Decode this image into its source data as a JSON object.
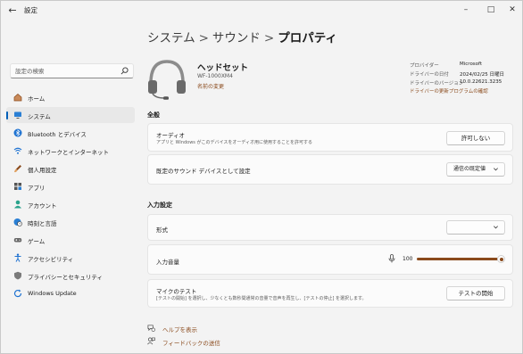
{
  "app": {
    "title": "設定"
  },
  "search": {
    "placeholder": "設定の検索"
  },
  "sidebar": {
    "items": [
      {
        "label": "ホーム",
        "icon": "home-icon"
      },
      {
        "label": "システム",
        "icon": "system-icon",
        "selected": true
      },
      {
        "label": "Bluetooth とデバイス",
        "icon": "bluetooth-icon"
      },
      {
        "label": "ネットワークとインターネット",
        "icon": "wifi-icon"
      },
      {
        "label": "個人用設定",
        "icon": "brush-icon"
      },
      {
        "label": "アプリ",
        "icon": "apps-icon"
      },
      {
        "label": "アカウント",
        "icon": "account-icon"
      },
      {
        "label": "時刻と言語",
        "icon": "globe-clock-icon"
      },
      {
        "label": "ゲーム",
        "icon": "gamepad-icon"
      },
      {
        "label": "アクセシビリティ",
        "icon": "accessibility-icon"
      },
      {
        "label": "プライバシーとセキュリティ",
        "icon": "shield-icon"
      },
      {
        "label": "Windows Update",
        "icon": "update-icon"
      }
    ]
  },
  "breadcrumb": {
    "part1": "システム",
    "sep": ">",
    "part2": "サウンド",
    "part3": "プロパティ"
  },
  "device": {
    "name": "ヘッドセット",
    "model": "WF-1000XM4",
    "rename": "名前の変更",
    "info": [
      {
        "key": "プロバイダー",
        "value": "Microsoft"
      },
      {
        "key": "ドライバーの日付",
        "value": "2024/02/25 日曜日"
      },
      {
        "key": "ドライバーのバージョン",
        "value": "10.0.22621.3235"
      }
    ],
    "driver_link": "ドライバーの更新プログラムの確認"
  },
  "general": {
    "heading": "全般",
    "audio_title": "オーディオ",
    "audio_desc": "アプリと Windows がこのデバイスをオーディオ用に使用することを許可する",
    "audio_button": "許可しない",
    "default_title": "既定のサウンド デバイスとして設定",
    "default_value": "通信の既定値"
  },
  "input": {
    "heading": "入力設定",
    "format_title": "形式",
    "format_value": "",
    "volume_title": "入力音量",
    "volume_value": "100",
    "volume_level": 100,
    "mictest_title": "マイクのテスト",
    "mictest_desc": "[テストの開始] を選択し、少なくとも数秒間通常の音量で音声を再生し、[テストの停止] を選択します。",
    "mictest_button": "テストの開始"
  },
  "footer": {
    "help": "ヘルプを表示",
    "feedback": "フィードバックの送信"
  },
  "colors": {
    "accent": "#8a4a1c",
    "nav_indicator": "#005fb8"
  }
}
